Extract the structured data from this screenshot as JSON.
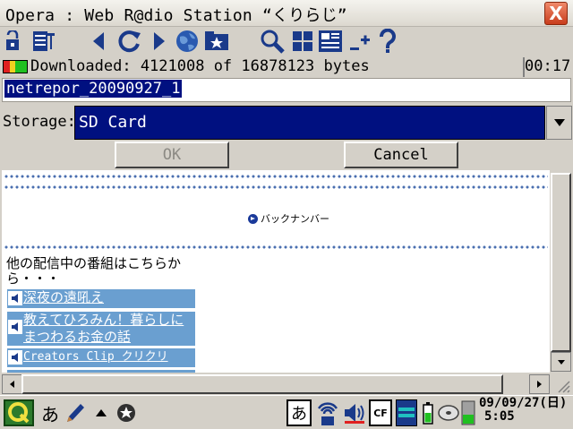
{
  "window": {
    "title": "Opera : Web R@dio Station “くりらじ”",
    "close_label": "X"
  },
  "toolbar": {
    "buttons": [
      "lock-icon",
      "menu-icon",
      "back-icon",
      "reload-icon",
      "forward-icon",
      "globe-icon",
      "bookmarks-icon",
      "search-icon",
      "grid-view-icon",
      "full-view-icon",
      "zoom-icon",
      "help-icon"
    ]
  },
  "download": {
    "status": "Downloaded: 4121008 of 16878123 bytes",
    "elapsed": "00:17",
    "filename": "netrepor_20090927_1"
  },
  "storage": {
    "label": "Storage:",
    "value": "SD Card"
  },
  "buttons": {
    "ok": "OK",
    "cancel": "Cancel"
  },
  "page": {
    "back_number": "バックナンバー",
    "intro": "他の配信中の番組はこちらから・・・",
    "programs": [
      "深夜の遠吼え",
      "教えてひろみん！暮らしにまつわるお金の話",
      "Creators Clip クリクリ"
    ]
  },
  "taskbar": {
    "input_mode": "あ",
    "ime_label": "あ",
    "card_label": "CF",
    "clock_date": "09/09/27(日)",
    "clock_time": "5:05"
  },
  "colors": {
    "selection": "#001080",
    "program_bg": "#6a9fd0",
    "close": "#d04a2a"
  }
}
